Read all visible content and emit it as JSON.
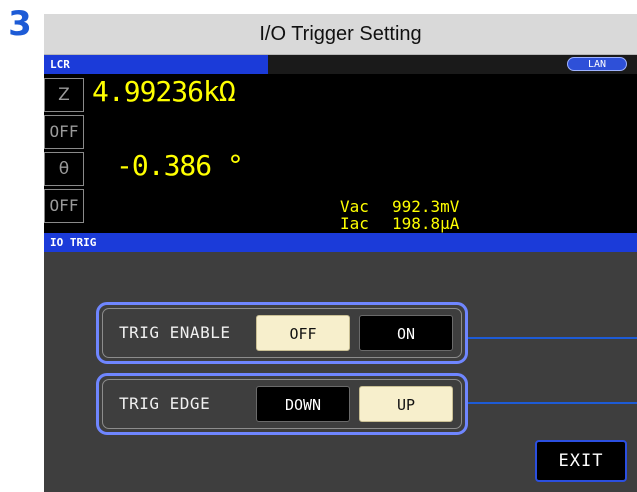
{
  "step_number": "3",
  "title": "I/O Trigger Setting",
  "status_bar": {
    "mode_tab": "LCR",
    "lan_badge": "LAN"
  },
  "measurement": {
    "param1": "Z",
    "param1_value": "4.99236kΩ",
    "param2": "OFF",
    "param3": "θ",
    "param3_value": "-0.386 °",
    "param4": "OFF",
    "monitor": [
      {
        "label": "Vac",
        "value": "992.3mV"
      },
      {
        "label": "Iac",
        "value": "198.8μA"
      }
    ]
  },
  "section_header": "IO TRIG",
  "trig_enable": {
    "label": "TRIG ENABLE",
    "options": [
      "OFF",
      "ON"
    ],
    "selected": "OFF"
  },
  "trig_edge": {
    "label": "TRIG EDGE",
    "options": [
      "DOWN",
      "UP"
    ],
    "selected": "UP"
  },
  "exit_label": "EXIT",
  "colors": {
    "accent_blue": "#1b3bd9",
    "value_yellow": "#ffff00",
    "selected_button": "#f7efcc",
    "frame_blue": "#6f86ff"
  }
}
